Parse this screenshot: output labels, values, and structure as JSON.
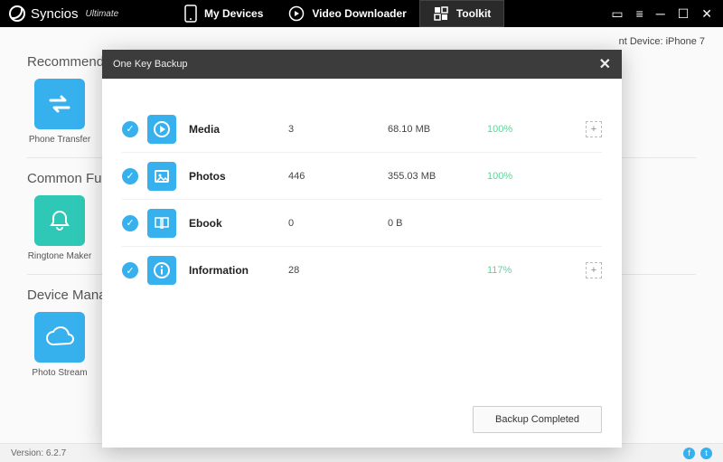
{
  "brand": {
    "name": "Syncios",
    "edition": "Ultimate"
  },
  "nav": {
    "devices": "My Devices",
    "video": "Video Downloader",
    "toolkit": "Toolkit"
  },
  "status": {
    "current_device_label": "nt Device: iPhone 7"
  },
  "sections": {
    "recommended": "Recommended",
    "common": "Common Functions",
    "device": "Device Management"
  },
  "tiles": {
    "phone_transfer": "Phone Transfer",
    "ringtone_maker": "Ringtone Maker",
    "photo_stream": "Photo Stream"
  },
  "footer": {
    "version": "Version: 6.2.7"
  },
  "modal": {
    "title": "One Key Backup",
    "done_label": "Backup Completed",
    "rows": [
      {
        "name": "Media",
        "count": "3",
        "size": "68.10 MB",
        "pct": "100%",
        "action": true
      },
      {
        "name": "Photos",
        "count": "446",
        "size": "355.03 MB",
        "pct": "100%",
        "action": false
      },
      {
        "name": "Ebook",
        "count": "0",
        "size": "0 B",
        "pct": "",
        "action": false
      },
      {
        "name": "Information",
        "count": "28",
        "size": "",
        "pct": "117%",
        "action": true
      }
    ]
  }
}
